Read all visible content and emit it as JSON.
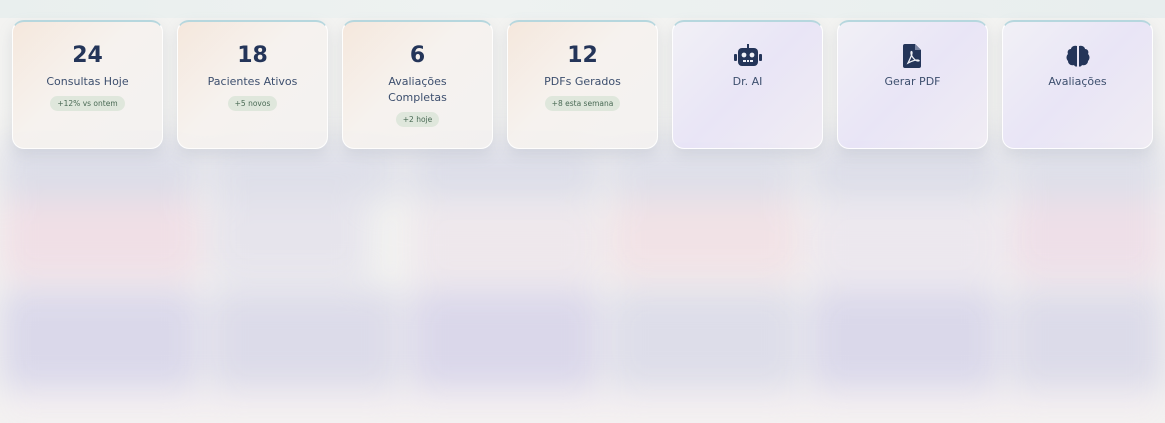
{
  "stats": [
    {
      "value": "24",
      "label": "Consultas Hoje",
      "badge": "+12% vs ontem"
    },
    {
      "value": "18",
      "label": "Pacientes Ativos",
      "badge": "+5 novos"
    },
    {
      "value": "6",
      "label": "Avaliações Completas",
      "badge": "+2 hoje"
    },
    {
      "value": "12",
      "label": "PDFs Gerados",
      "badge": "+8 esta semana"
    }
  ],
  "actions": [
    {
      "icon": "robot-icon",
      "label": "Dr. AI"
    },
    {
      "icon": "file-pdf-icon",
      "label": "Gerar PDF"
    },
    {
      "icon": "brain-icon",
      "label": "Avaliações"
    }
  ],
  "colors": {
    "primary": "#243559",
    "badge_bg": "#dfe7dc",
    "badge_text": "#4a6a55"
  }
}
